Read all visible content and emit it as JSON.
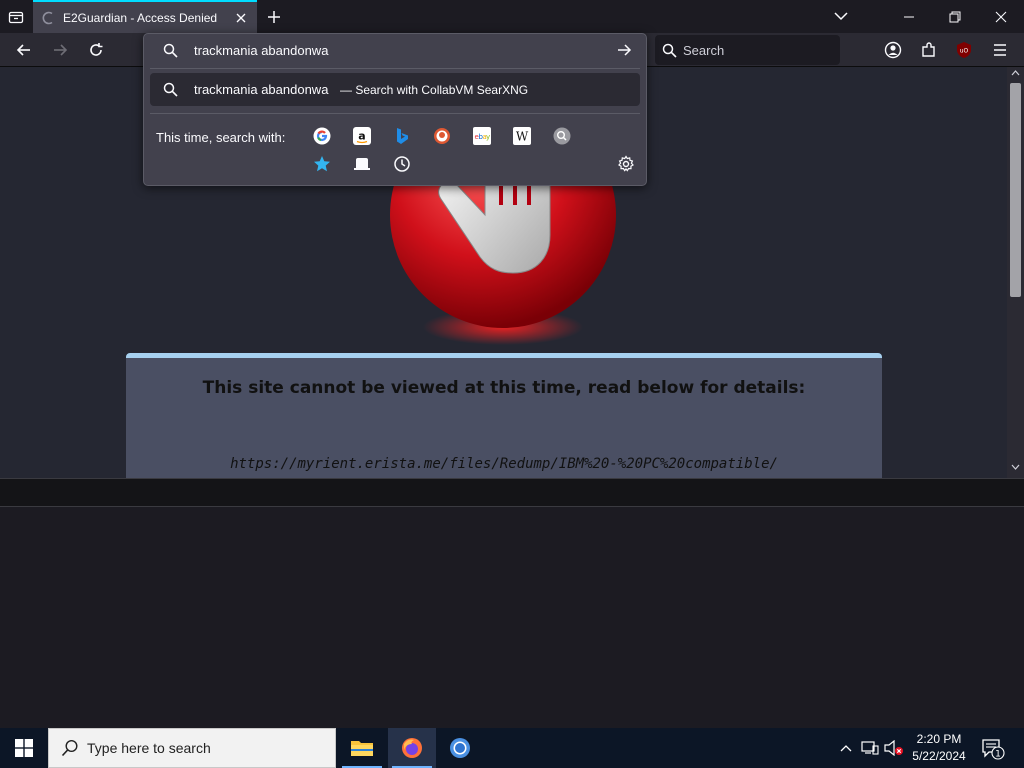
{
  "browser": {
    "tab": {
      "title": "E2Guardian - Access Denied"
    },
    "urlbar": {
      "query": "trackmania abandonwa",
      "result_query": "trackmania abandonwa",
      "result_action": "— Search with CollabVM SearXNG",
      "one_off_label": "This time, search with:",
      "engines": [
        "google-icon",
        "amazon-icon",
        "bing-icon",
        "duckduckgo-icon",
        "ebay-icon",
        "wikipedia-icon",
        "searxng-icon",
        "bookmarks-icon",
        "tabs-icon",
        "history-icon"
      ]
    },
    "search": {
      "placeholder": "Search"
    },
    "toolbar_icons": [
      "back-icon",
      "forward-icon",
      "reload-icon",
      "account-icon",
      "extensions-icon",
      "ublock-icon",
      "menu-icon"
    ]
  },
  "page": {
    "headline": "This site cannot be viewed at this time, read below for details:",
    "blocked_url": "https://myrient.erista.me/files/Redump/IBM%20-%20PC%20compatible/"
  },
  "taskbar": {
    "search_placeholder": "Type here to search",
    "clock_time": "2:20 PM",
    "clock_date": "5/22/2024",
    "notification_count": "1"
  },
  "colors": {
    "accent": "#00ddff",
    "panel": "#4a4f63",
    "stop_red": "#d0101a"
  }
}
